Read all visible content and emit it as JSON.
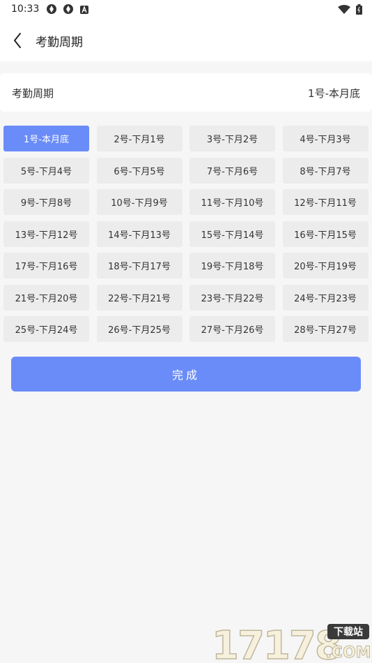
{
  "status_bar": {
    "time": "10:33",
    "left_icons": [
      "aperture-icon",
      "aperture-icon",
      "a-box-icon"
    ],
    "right_icons": [
      "wifi-icon",
      "battery-icon"
    ]
  },
  "header": {
    "title": "考勤周期",
    "back_icon": "back-chevron-icon"
  },
  "period_card": {
    "label": "考勤周期",
    "value": "1号-本月底"
  },
  "options": [
    {
      "label": "1号-本月底",
      "selected": true
    },
    {
      "label": "2号-下月1号"
    },
    {
      "label": "3号-下月2号"
    },
    {
      "label": "4号-下月3号"
    },
    {
      "label": "5号-下月4号"
    },
    {
      "label": "6号-下月5号"
    },
    {
      "label": "7号-下月6号"
    },
    {
      "label": "8号-下月7号"
    },
    {
      "label": "9号-下月8号"
    },
    {
      "label": "10号-下月9号"
    },
    {
      "label": "11号-下月10号"
    },
    {
      "label": "12号-下月11号"
    },
    {
      "label": "13号-下月12号"
    },
    {
      "label": "14号-下月13号"
    },
    {
      "label": "15号-下月14号"
    },
    {
      "label": "16号-下月15号"
    },
    {
      "label": "17号-下月16号"
    },
    {
      "label": "18号-下月17号"
    },
    {
      "label": "19号-下月18号"
    },
    {
      "label": "20号-下月19号"
    },
    {
      "label": "21号-下月20号"
    },
    {
      "label": "22号-下月21号"
    },
    {
      "label": "23号-下月22号"
    },
    {
      "label": "24号-下月23号"
    },
    {
      "label": "25号-下月24号"
    },
    {
      "label": "26号-下月25号"
    },
    {
      "label": "27号-下月26号"
    },
    {
      "label": "28号-下月27号"
    }
  ],
  "done_button": {
    "label": "完成"
  },
  "watermark": {
    "text": "17178下载站.COM"
  },
  "colors": {
    "accent": "#6a8cf8",
    "option_bg": "#ececec",
    "page_bg": "#f6f6f7"
  }
}
